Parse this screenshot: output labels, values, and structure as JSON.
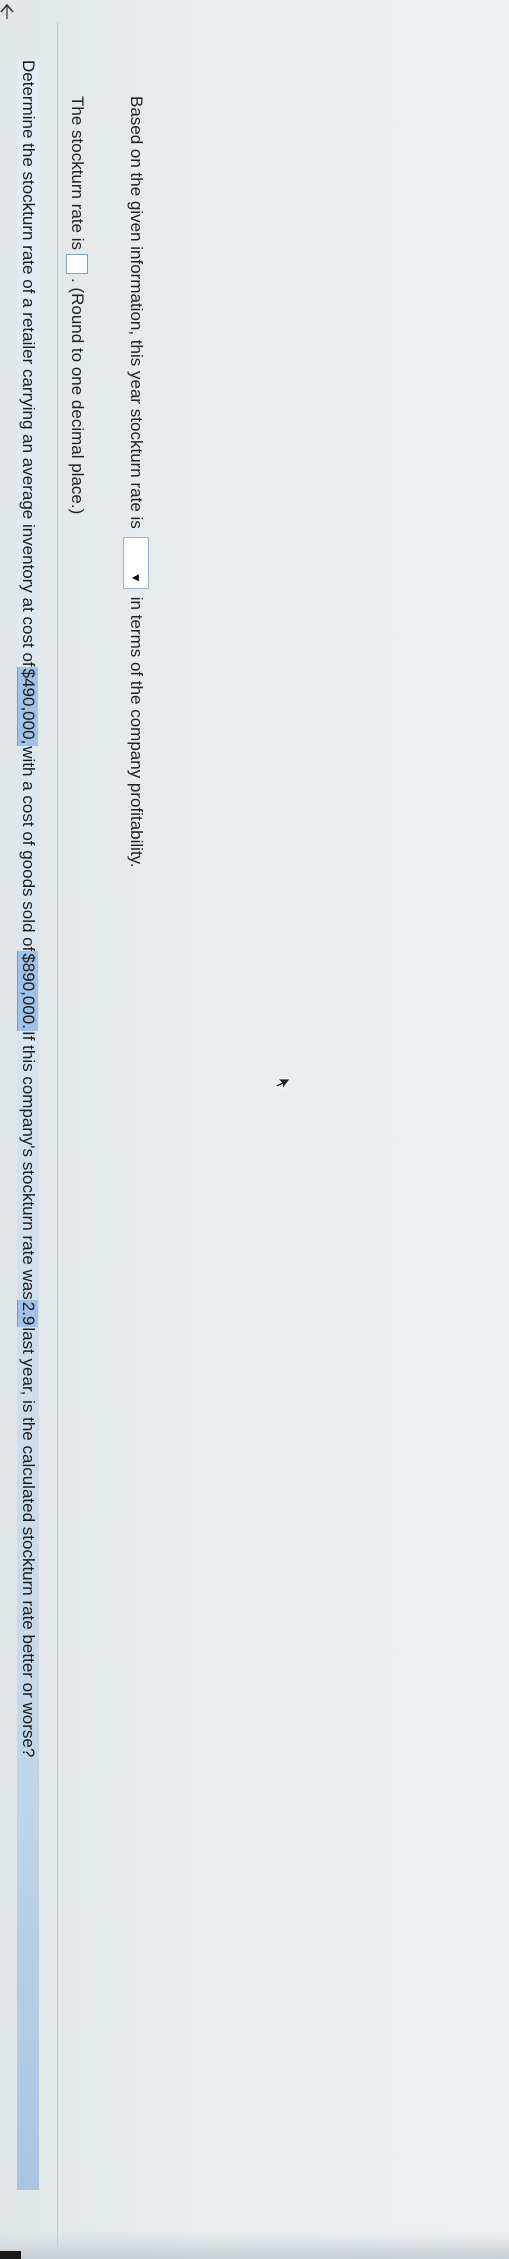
{
  "question": {
    "part1": "Determine the stockturn rate of a retailer carrying an average inventory at cost of ",
    "inventory": "$490,000,",
    "part2": " with a cost of goods sold of ",
    "cogs": "$890,000.",
    "part3": " If this company's stockturn rate was ",
    "last_rate": "2.9",
    "part4": " last year, is the calculated stockturn rate better or worse?"
  },
  "stockturn_line": {
    "prefix": "The stockturn rate is",
    "answer_value": "",
    "suffix": ". (Round to one decimal place.)"
  },
  "comparison_line": {
    "prefix": "Based on the given information, this year stockturn rate is",
    "dropdown_selected": "",
    "dropdown_arrow": "▼",
    "suffix": "in terms of the company profitability."
  },
  "icons": {
    "back": "chevron-left-icon",
    "pointer": "mouse-pointer-icon"
  },
  "colors": {
    "highlight": "#9fc2e6",
    "question_band": "#c7d9ea",
    "input_border": "#7f9fc3"
  }
}
